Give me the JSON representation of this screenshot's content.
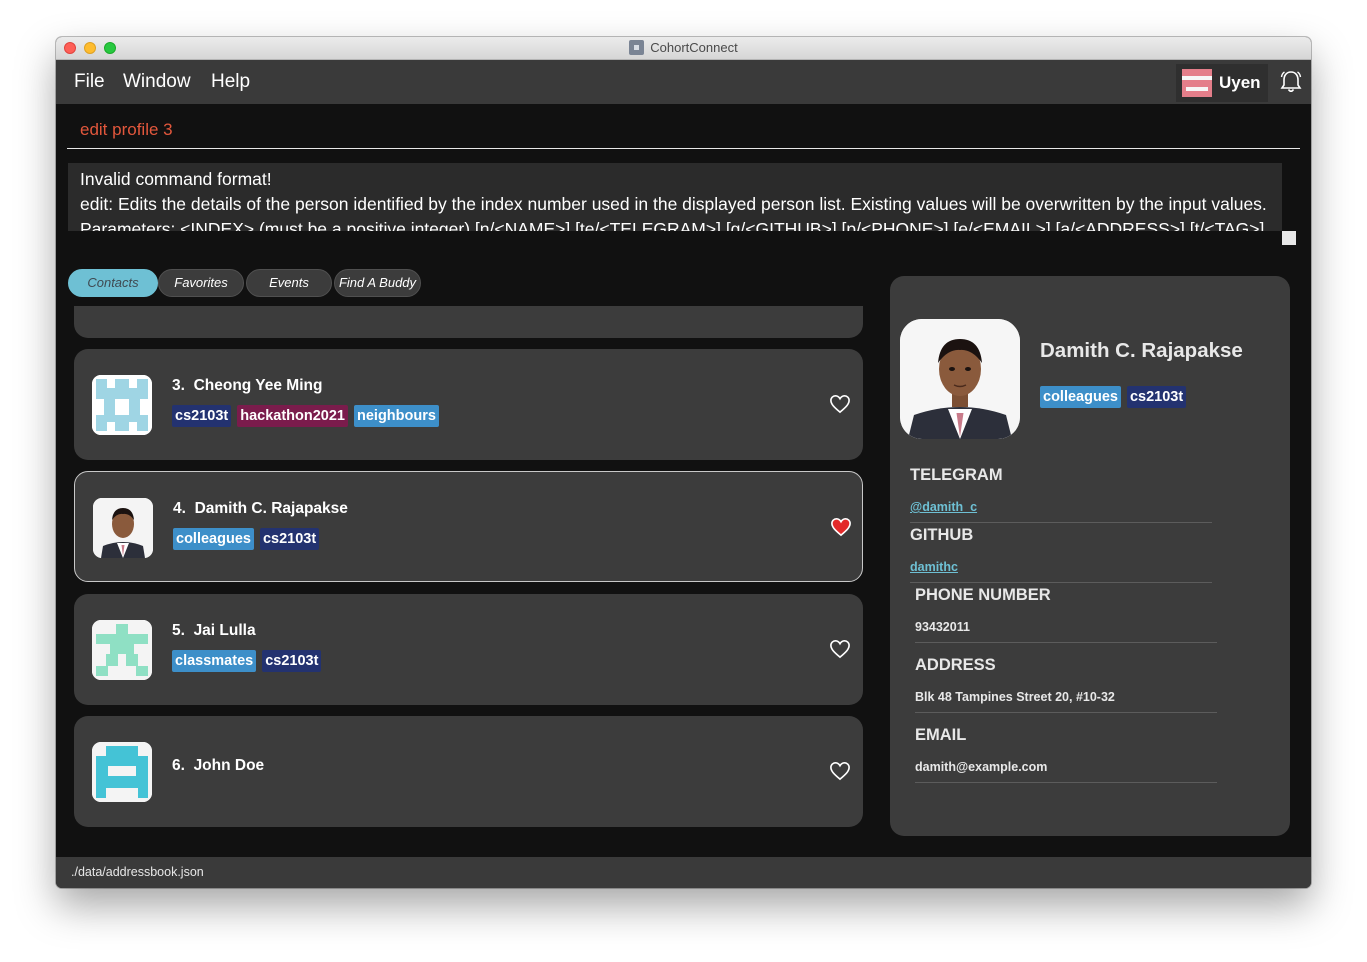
{
  "window": {
    "title": "CohortConnect"
  },
  "menu": {
    "items": [
      "File",
      "Window",
      "Help"
    ]
  },
  "user": {
    "name": "Uyen"
  },
  "command": {
    "text": "edit profile 3"
  },
  "result": {
    "lines": [
      "Invalid command format!",
      "edit: Edits the details of the person identified by the index number used in the displayed person list. Existing values will be overwritten by the input values.",
      "Parameters: <INDEX> (must be a positive integer) [n/<NAME>] [te/<TELEGRAM>] [g/<GITHUB>] [p/<PHONE>] [e/<EMAIL>] [a/<ADDRESS>] [t/<TAG>]..."
    ]
  },
  "tabs": [
    {
      "label": "Contacts",
      "active": true
    },
    {
      "label": "Favorites",
      "active": false
    },
    {
      "label": "Events",
      "active": false
    },
    {
      "label": "Find A Buddy",
      "active": false
    }
  ],
  "colors": {
    "tag_blue": "#3d8fc9",
    "tag_navy": "#233270",
    "tag_maroon": "#7a1c4c",
    "accent": "#6ec0d4",
    "command_text": "#e2573c",
    "heart_red": "#e32a2a"
  },
  "contacts": [
    {
      "index": "3.",
      "name": "Cheong Yee Ming",
      "tags": [
        {
          "label": "cs2103t",
          "color": "#233270"
        },
        {
          "label": "hackathon2021",
          "color": "#7a1c4c"
        },
        {
          "label": "neighbours",
          "color": "#3d8fc9"
        }
      ],
      "favorite": false,
      "avatar": "identicon-blue"
    },
    {
      "index": "4.",
      "name": "Damith C. Rajapakse",
      "tags": [
        {
          "label": "colleagues",
          "color": "#3d8fc9"
        },
        {
          "label": "cs2103t",
          "color": "#233270"
        }
      ],
      "favorite": true,
      "avatar": "portrait-photo"
    },
    {
      "index": "5.",
      "name": "Jai Lulla",
      "tags": [
        {
          "label": "classmates",
          "color": "#3d8fc9"
        },
        {
          "label": "cs2103t",
          "color": "#233270"
        }
      ],
      "favorite": false,
      "avatar": "identicon-green"
    },
    {
      "index": "6.",
      "name": "John Doe",
      "tags": [],
      "favorite": false,
      "avatar": "identicon-teal"
    }
  ],
  "profile": {
    "name": "Damith C. Rajapakse",
    "tags": [
      {
        "label": "colleagues",
        "color": "#3d8fc9"
      },
      {
        "label": "cs2103t",
        "color": "#233270"
      }
    ],
    "telegram_label": "TELEGRAM",
    "telegram": "@damith_c",
    "github_label": "GITHUB",
    "github": "damithc",
    "phone_label": "PHONE NUMBER",
    "phone": "93432011",
    "address_label": "ADDRESS",
    "address": "Blk 48 Tampines Street 20, #10-32",
    "email_label": "EMAIL",
    "email": "damith@example.com"
  },
  "status": {
    "path": "./data/addressbook.json"
  }
}
